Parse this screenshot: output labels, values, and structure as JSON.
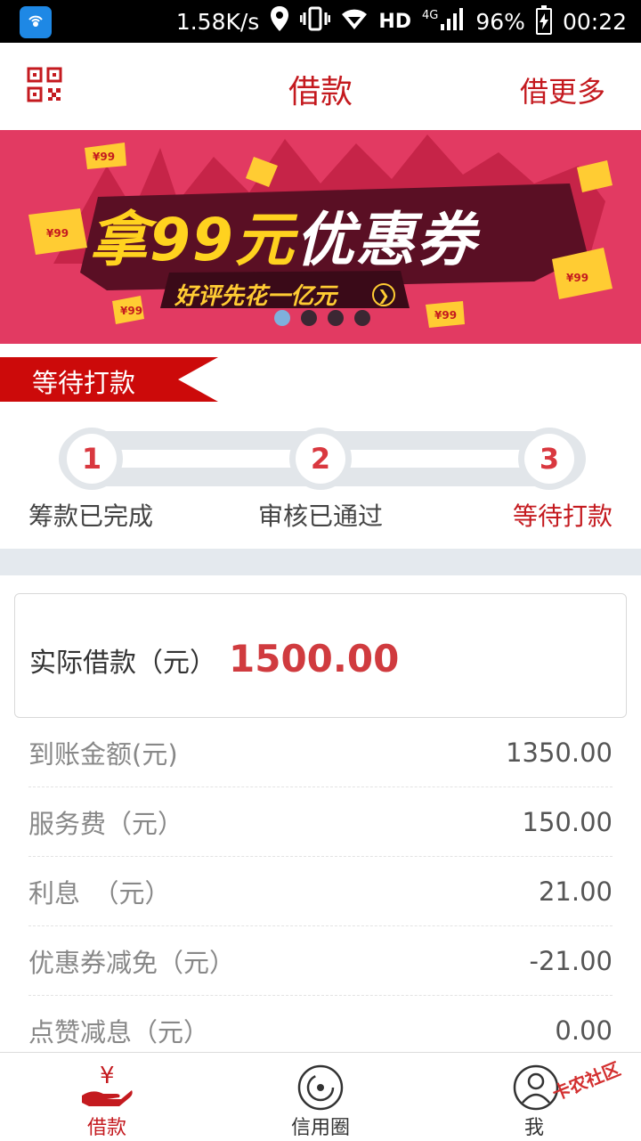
{
  "status_bar": {
    "speed": "1.58K/s",
    "hd": "HD",
    "network": "4G",
    "battery": "96%",
    "time": "00:22"
  },
  "header": {
    "title": "借款",
    "right_link": "借更多"
  },
  "banner": {
    "title_highlight": "拿99元",
    "title_main": "优惠券",
    "subtitle": "好评先花一亿元",
    "tag": "¥99",
    "slide_count": 4,
    "active_slide": 1
  },
  "status_ribbon": "等待打款",
  "steps": [
    {
      "number": "1",
      "label": "筹款已完成"
    },
    {
      "number": "2",
      "label": "审核已通过"
    },
    {
      "number": "3",
      "label": "等待打款"
    }
  ],
  "loan_card": {
    "label": "实际借款（元）",
    "value": "1500.00"
  },
  "details": [
    {
      "label": "到账金额(元)",
      "value": "1350.00"
    },
    {
      "label": "服务费（元）",
      "value": "150.00"
    },
    {
      "label": "利息　（元）",
      "value": "21.00"
    },
    {
      "label": "优惠券减免（元）",
      "value": "-21.00"
    },
    {
      "label": "点赞减息（元）",
      "value": "0.00"
    }
  ],
  "tabs": [
    {
      "label": "借款",
      "icon": "yen-hand-icon"
    },
    {
      "label": "信用圈",
      "icon": "circle-eye-icon"
    },
    {
      "label": "我",
      "icon": "user-icon"
    }
  ],
  "watermark": "卡农社区",
  "colors": {
    "brand_red": "#c41a1f",
    "banner_bg": "#e23a62",
    "amount_red": "#d03b3f"
  }
}
